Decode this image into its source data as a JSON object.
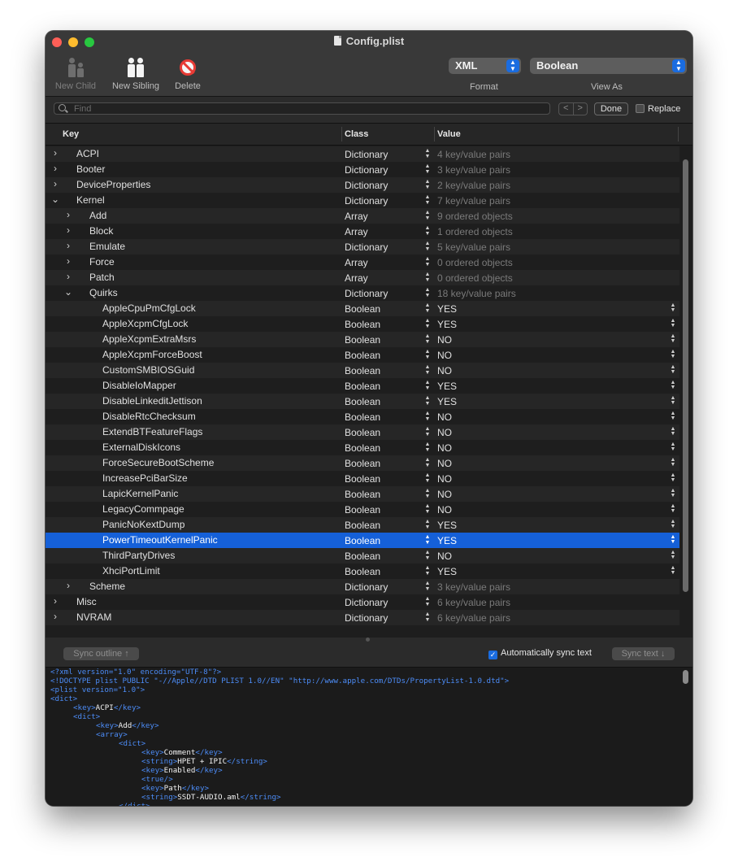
{
  "window": {
    "title": "Config.plist"
  },
  "toolbar": {
    "new_child": "New Child",
    "new_sibling": "New Sibling",
    "delete": "Delete",
    "format_value": "XML",
    "format_label": "Format",
    "viewas_value": "Boolean",
    "viewas_label": "View As"
  },
  "find": {
    "placeholder": "Find",
    "prev": "<",
    "next": ">",
    "done": "Done",
    "replace": "Replace"
  },
  "columns": {
    "key": "Key",
    "class": "Class",
    "value": "Value"
  },
  "rows": [
    {
      "level": 0,
      "disclosure": "collapsed",
      "key": "ACPI",
      "class": "Dictionary",
      "value": "4 key/value pairs",
      "dim": true
    },
    {
      "level": 0,
      "disclosure": "collapsed",
      "key": "Booter",
      "class": "Dictionary",
      "value": "3 key/value pairs",
      "dim": true
    },
    {
      "level": 0,
      "disclosure": "collapsed",
      "key": "DeviceProperties",
      "class": "Dictionary",
      "value": "2 key/value pairs",
      "dim": true
    },
    {
      "level": 0,
      "disclosure": "expanded",
      "key": "Kernel",
      "class": "Dictionary",
      "value": "7 key/value pairs",
      "dim": true
    },
    {
      "level": 1,
      "disclosure": "collapsed",
      "key": "Add",
      "class": "Array",
      "value": "9 ordered objects",
      "dim": true
    },
    {
      "level": 1,
      "disclosure": "collapsed",
      "key": "Block",
      "class": "Array",
      "value": "1 ordered objects",
      "dim": true
    },
    {
      "level": 1,
      "disclosure": "collapsed",
      "key": "Emulate",
      "class": "Dictionary",
      "value": "5 key/value pairs",
      "dim": true
    },
    {
      "level": 1,
      "disclosure": "collapsed",
      "key": "Force",
      "class": "Array",
      "value": "0 ordered objects",
      "dim": true
    },
    {
      "level": 1,
      "disclosure": "collapsed",
      "key": "Patch",
      "class": "Array",
      "value": "0 ordered objects",
      "dim": true
    },
    {
      "level": 1,
      "disclosure": "expanded",
      "key": "Quirks",
      "class": "Dictionary",
      "value": "18 key/value pairs",
      "dim": true
    },
    {
      "level": 2,
      "disclosure": "none",
      "key": "AppleCpuPmCfgLock",
      "class": "Boolean",
      "value": "YES",
      "dim": false
    },
    {
      "level": 2,
      "disclosure": "none",
      "key": "AppleXcpmCfgLock",
      "class": "Boolean",
      "value": "YES",
      "dim": false
    },
    {
      "level": 2,
      "disclosure": "none",
      "key": "AppleXcpmExtraMsrs",
      "class": "Boolean",
      "value": "NO",
      "dim": false
    },
    {
      "level": 2,
      "disclosure": "none",
      "key": "AppleXcpmForceBoost",
      "class": "Boolean",
      "value": "NO",
      "dim": false
    },
    {
      "level": 2,
      "disclosure": "none",
      "key": "CustomSMBIOSGuid",
      "class": "Boolean",
      "value": "NO",
      "dim": false
    },
    {
      "level": 2,
      "disclosure": "none",
      "key": "DisableIoMapper",
      "class": "Boolean",
      "value": "YES",
      "dim": false
    },
    {
      "level": 2,
      "disclosure": "none",
      "key": "DisableLinkeditJettison",
      "class": "Boolean",
      "value": "YES",
      "dim": false
    },
    {
      "level": 2,
      "disclosure": "none",
      "key": "DisableRtcChecksum",
      "class": "Boolean",
      "value": "NO",
      "dim": false
    },
    {
      "level": 2,
      "disclosure": "none",
      "key": "ExtendBTFeatureFlags",
      "class": "Boolean",
      "value": "NO",
      "dim": false
    },
    {
      "level": 2,
      "disclosure": "none",
      "key": "ExternalDiskIcons",
      "class": "Boolean",
      "value": "NO",
      "dim": false
    },
    {
      "level": 2,
      "disclosure": "none",
      "key": "ForceSecureBootScheme",
      "class": "Boolean",
      "value": "NO",
      "dim": false
    },
    {
      "level": 2,
      "disclosure": "none",
      "key": "IncreasePciBarSize",
      "class": "Boolean",
      "value": "NO",
      "dim": false
    },
    {
      "level": 2,
      "disclosure": "none",
      "key": "LapicKernelPanic",
      "class": "Boolean",
      "value": "NO",
      "dim": false
    },
    {
      "level": 2,
      "disclosure": "none",
      "key": "LegacyCommpage",
      "class": "Boolean",
      "value": "NO",
      "dim": false
    },
    {
      "level": 2,
      "disclosure": "none",
      "key": "PanicNoKextDump",
      "class": "Boolean",
      "value": "YES",
      "dim": false
    },
    {
      "level": 2,
      "disclosure": "none",
      "key": "PowerTimeoutKernelPanic",
      "class": "Boolean",
      "value": "YES",
      "dim": false,
      "selected": true
    },
    {
      "level": 2,
      "disclosure": "none",
      "key": "ThirdPartyDrives",
      "class": "Boolean",
      "value": "NO",
      "dim": false
    },
    {
      "level": 2,
      "disclosure": "none",
      "key": "XhciPortLimit",
      "class": "Boolean",
      "value": "YES",
      "dim": false
    },
    {
      "level": 1,
      "disclosure": "collapsed",
      "key": "Scheme",
      "class": "Dictionary",
      "value": "3 key/value pairs",
      "dim": true
    },
    {
      "level": 0,
      "disclosure": "collapsed",
      "key": "Misc",
      "class": "Dictionary",
      "value": "6 key/value pairs",
      "dim": true
    },
    {
      "level": 0,
      "disclosure": "collapsed",
      "key": "NVRAM",
      "class": "Dictionary",
      "value": "6 key/value pairs",
      "dim": true
    }
  ],
  "bottom": {
    "sync_outline": "Sync outline ↑",
    "auto_sync": "Automatically sync text",
    "sync_text": "Sync text ↓"
  },
  "xml_lines": [
    {
      "indent": 0,
      "parts": [
        [
          "t",
          "<?xml version=\"1.0\" encoding=\"UTF-8\"?>"
        ]
      ]
    },
    {
      "indent": 0,
      "parts": [
        [
          "t",
          "<!DOCTYPE plist PUBLIC \"-//Apple//DTD PLIST 1.0//EN\" \"http://www.apple.com/DTDs/PropertyList-1.0.dtd\">"
        ]
      ]
    },
    {
      "indent": 0,
      "parts": [
        [
          "t",
          "<plist version=\"1.0\">"
        ]
      ]
    },
    {
      "indent": 0,
      "parts": [
        [
          "t",
          "<dict>"
        ]
      ]
    },
    {
      "indent": 1,
      "parts": [
        [
          "t",
          "<key>"
        ],
        [
          "x",
          "ACPI"
        ],
        [
          "t",
          "</key>"
        ]
      ]
    },
    {
      "indent": 1,
      "parts": [
        [
          "t",
          "<dict>"
        ]
      ]
    },
    {
      "indent": 2,
      "parts": [
        [
          "t",
          "<key>"
        ],
        [
          "x",
          "Add"
        ],
        [
          "t",
          "</key>"
        ]
      ]
    },
    {
      "indent": 2,
      "parts": [
        [
          "t",
          "<array>"
        ]
      ]
    },
    {
      "indent": 3,
      "parts": [
        [
          "t",
          "<dict>"
        ]
      ]
    },
    {
      "indent": 4,
      "parts": [
        [
          "t",
          "<key>"
        ],
        [
          "x",
          "Comment"
        ],
        [
          "t",
          "</key>"
        ]
      ]
    },
    {
      "indent": 4,
      "parts": [
        [
          "t",
          "<string>"
        ],
        [
          "x",
          "HPET + IPIC"
        ],
        [
          "t",
          "</string>"
        ]
      ]
    },
    {
      "indent": 4,
      "parts": [
        [
          "t",
          "<key>"
        ],
        [
          "x",
          "Enabled"
        ],
        [
          "t",
          "</key>"
        ]
      ]
    },
    {
      "indent": 4,
      "parts": [
        [
          "t",
          "<true/>"
        ]
      ]
    },
    {
      "indent": 4,
      "parts": [
        [
          "t",
          "<key>"
        ],
        [
          "x",
          "Path"
        ],
        [
          "t",
          "</key>"
        ]
      ]
    },
    {
      "indent": 4,
      "parts": [
        [
          "t",
          "<string>"
        ],
        [
          "x",
          "SSDT-AUDIO.aml"
        ],
        [
          "t",
          "</string>"
        ]
      ]
    },
    {
      "indent": 3,
      "parts": [
        [
          "t",
          "</dict>"
        ]
      ]
    }
  ]
}
